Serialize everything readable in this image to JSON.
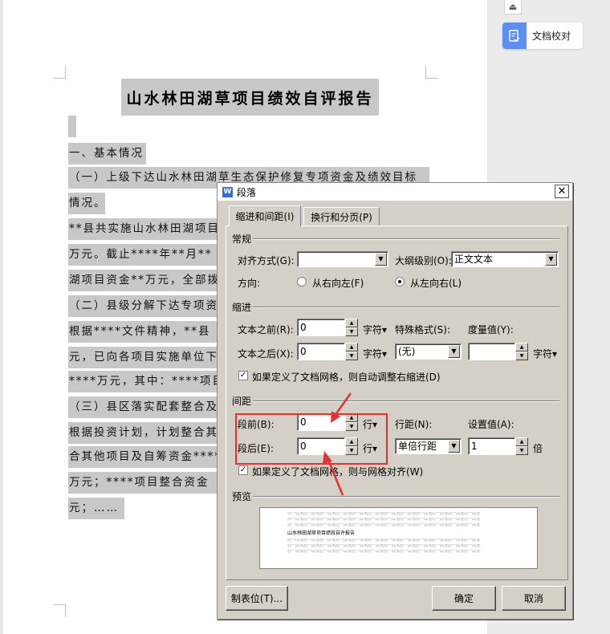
{
  "document": {
    "title": "山水林田湖草项目绩效自评报告",
    "lines": [
      "一、基本情况",
      "（一）上级下达山水林田湖草生态保护修复专项资金及绩效目标",
      "情况。",
      "**县共实施山水林田湖项目",
      "万元。截止****年**月**",
      "湖项目资金**万元，全部拨",
      "（二）县级分解下达专项资",
      "根据****文件精神，**县",
      "元，已向各项目实施单位下",
      "****万元，其中：****项目",
      "（三）县区落实配套整合及",
      "根据投资计划，计划整合其",
      "合其他项目及自筹资金****",
      "万元；****项目整合资金",
      "元；……"
    ]
  },
  "side_panel": {
    "proofread_label": "文档校对"
  },
  "dialog": {
    "title": "段落",
    "close": "✕",
    "tabs": [
      "缩进和间距(I)",
      "换行和分页(P)"
    ],
    "general": {
      "label": "常规",
      "alignment_label": "对齐方式(G):",
      "alignment_value": "",
      "outline_label": "大纲级别(O):",
      "outline_value": "正文文本",
      "direction_label": "方向:",
      "rtl_label": "从右向左(F)",
      "ltr_label": "从左向右(L)"
    },
    "indent": {
      "label": "缩进",
      "before_label": "文本之前(R):",
      "before_value": "0",
      "before_unit": "字符▾",
      "after_label": "文本之后(X):",
      "after_value": "0",
      "after_unit": "字符▾",
      "special_label": "特殊格式(S):",
      "special_value": "(无)",
      "measure_label": "度量值(Y):",
      "measure_value": "",
      "measure_unit": "字符▾",
      "grid_check_label": "如果定义了文档网格，则自动调整右缩进(D)"
    },
    "spacing": {
      "label": "间距",
      "before_label": "段前(B):",
      "before_value": "0",
      "before_unit": "行▾",
      "after_label": "段后(E):",
      "after_value": "0",
      "after_unit": "行▾",
      "line_label": "行距(N):",
      "line_value": "单倍行距",
      "set_label": "设置值(A):",
      "set_value": "1",
      "set_unit": "倍",
      "grid_check_label": "如果定义了文档网格，则与网格对齐(W)"
    },
    "preview": {
      "label": "预览",
      "before_text": "前一段落前一段落前一段落前一段落前一段落前一段落前一段落前一段落前一段落前一段落前一段落前一段落",
      "main_text": "山水林田湖草项目绩效自评报告",
      "after_text": "后一段落后一段落后一段落后一段落后一段落后一段落后一段落后一段落后一段落后一段落后一段落后一段落"
    },
    "buttons": {
      "tabs": "制表位(T)...",
      "ok": "确定",
      "cancel": "取消"
    }
  }
}
